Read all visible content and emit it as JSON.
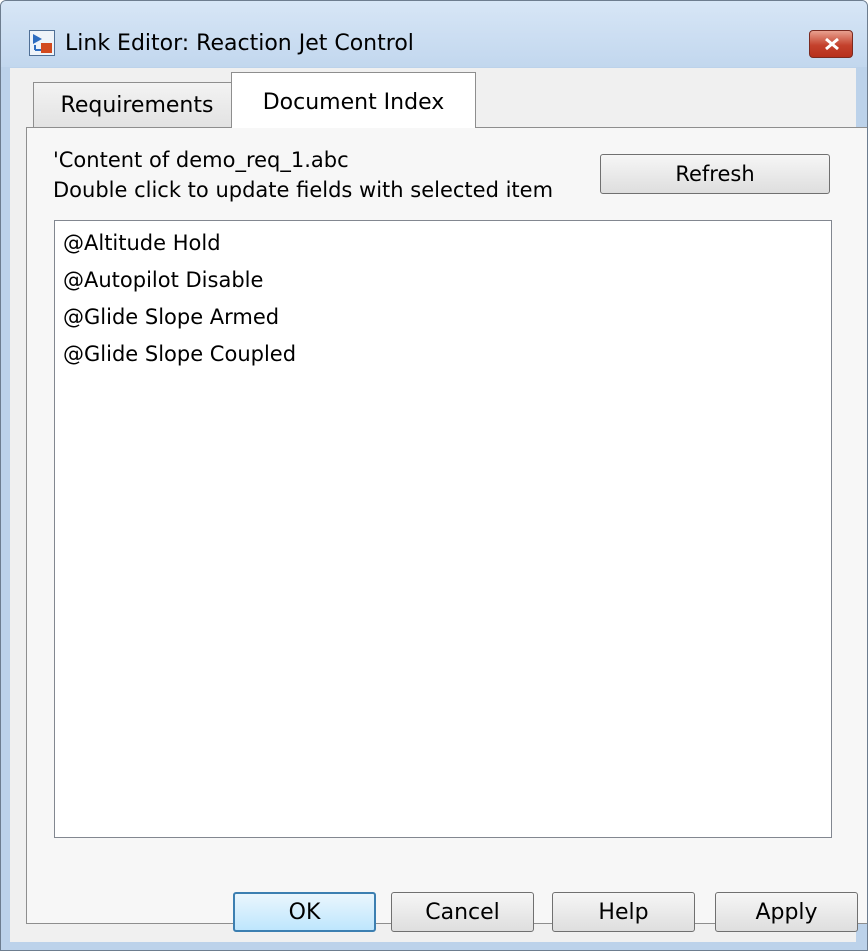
{
  "window": {
    "title": "Link Editor: Reaction Jet Control",
    "close_icon": "close-icon",
    "app_icon": "simulink-model-icon"
  },
  "tabs": [
    {
      "label": "Requirements",
      "active": false
    },
    {
      "label": "Document Index",
      "active": true
    }
  ],
  "document_index": {
    "content_label": "'Content of demo_req_1.abc",
    "hint": "Double click to update fields with selected item",
    "refresh_label": "Refresh",
    "items": [
      "@Altitude Hold",
      "@Autopilot Disable",
      "@Glide Slope Armed",
      "@Glide Slope Coupled"
    ]
  },
  "footer": {
    "ok": "OK",
    "cancel": "Cancel",
    "help": "Help",
    "apply": "Apply"
  },
  "colors": {
    "frame": "#bcd2ea",
    "close": "#c4412c",
    "default_button_border": "#3c7fb1"
  }
}
